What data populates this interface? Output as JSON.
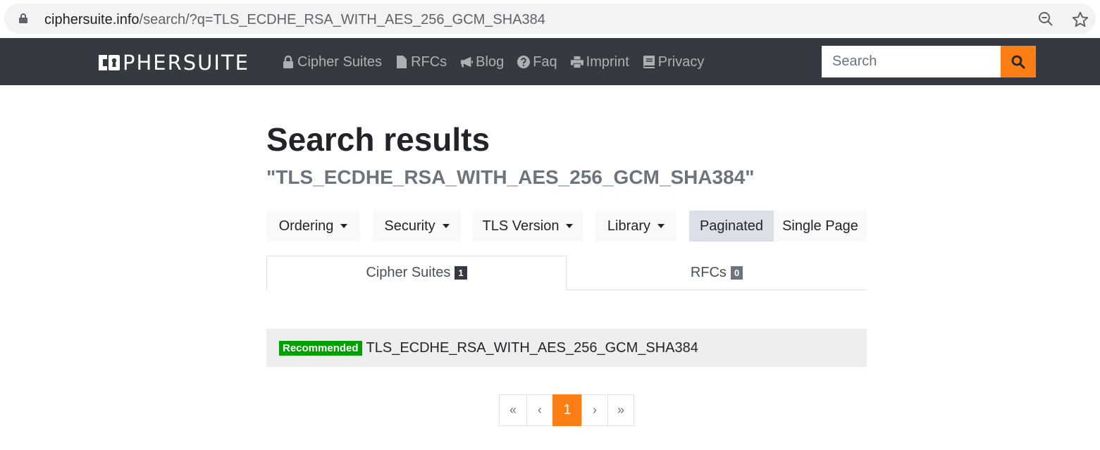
{
  "browser": {
    "url_host": "ciphersuite.info",
    "url_rest": "/search/?q=TLS_ECDHE_RSA_WITH_AES_256_GCM_SHA384"
  },
  "navbar": {
    "logo_text": "PHERSUITE",
    "items": [
      {
        "label": "Cipher Suites",
        "icon": "lock-icon"
      },
      {
        "label": "RFCs",
        "icon": "file-icon"
      },
      {
        "label": "Blog",
        "icon": "bullhorn-icon"
      },
      {
        "label": "Faq",
        "icon": "question-circle-icon"
      },
      {
        "label": "Imprint",
        "icon": "print-icon"
      },
      {
        "label": "Privacy",
        "icon": "book-icon"
      }
    ],
    "search_placeholder": "Search",
    "accent": "#fd7e14"
  },
  "main": {
    "title": "Search results",
    "query": "\"TLS_ECDHE_RSA_WITH_AES_256_GCM_SHA384\"",
    "filters": {
      "ordering": "Ordering",
      "security": "Security",
      "tls_version": "TLS Version",
      "library": "Library",
      "paginated": "Paginated",
      "single_page": "Single Page"
    },
    "tabs": [
      {
        "label": "Cipher Suites",
        "count": "1"
      },
      {
        "label": "RFCs",
        "count": "0"
      }
    ],
    "results": [
      {
        "badge": "Recommended",
        "name": "TLS_ECDHE_RSA_WITH_AES_256_GCM_SHA384",
        "badge_color": "#00a000"
      }
    ],
    "pagination": {
      "first": "«",
      "prev": "‹",
      "current": "1",
      "next": "›",
      "last": "»"
    }
  }
}
